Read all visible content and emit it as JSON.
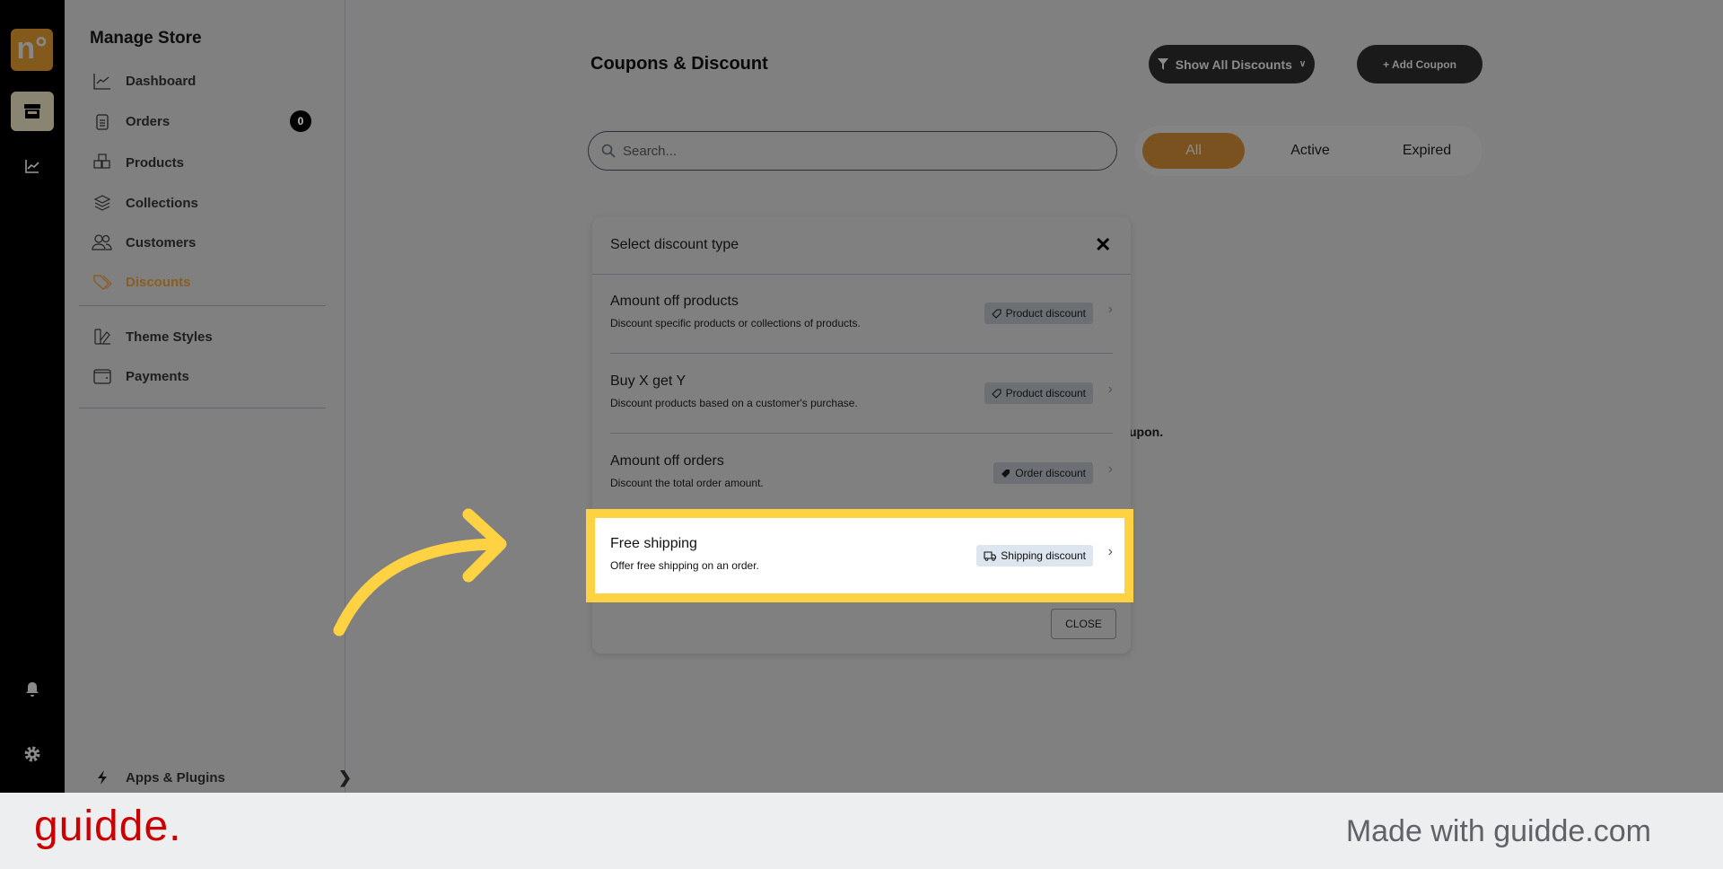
{
  "rail": {
    "logo": "n°",
    "icons": [
      "store-icon",
      "chart-icon",
      "bell-icon",
      "gear-icon"
    ]
  },
  "sidebar": {
    "title": "Manage Store",
    "items": [
      {
        "label": "Dashboard",
        "icon": "chart-line-icon"
      },
      {
        "label": "Orders",
        "icon": "clipboard-icon",
        "badge": "0"
      },
      {
        "label": "Products",
        "icon": "boxes-icon"
      },
      {
        "label": "Collections",
        "icon": "layers-icon"
      },
      {
        "label": "Customers",
        "icon": "users-icon"
      },
      {
        "label": "Discounts",
        "icon": "tag-icon",
        "active": true
      },
      {
        "label": "Theme Styles",
        "icon": "palette-icon"
      },
      {
        "label": "Payments",
        "icon": "wallet-icon"
      }
    ],
    "footer_item": {
      "label": "Apps & Plugins",
      "icon": "bolt-icon"
    }
  },
  "main": {
    "title": "Coupons & Discount",
    "filter_button": "Show All Discounts",
    "add_button": "+ Add Coupon",
    "search_placeholder": "Search...",
    "tabs": [
      "All",
      "Active",
      "Expired"
    ],
    "selected_tab": "All",
    "behind_text": "upon."
  },
  "modal": {
    "title": "Select discount type",
    "options": [
      {
        "title": "Amount off products",
        "desc": "Discount specific products or collections of products.",
        "tag": "Product discount",
        "tag_icon": "tag-outline-icon"
      },
      {
        "title": "Buy X get Y",
        "desc": "Discount products based on a customer's purchase.",
        "tag": "Product discount",
        "tag_icon": "tag-outline-icon"
      },
      {
        "title": "Amount off orders",
        "desc": "Discount the total order amount.",
        "tag": "Order discount",
        "tag_icon": "tag-filled-icon"
      },
      {
        "title": "Free shipping",
        "desc": "Offer free shipping on an order.",
        "tag": "Shipping discount",
        "tag_icon": "truck-icon",
        "highlighted": true
      }
    ],
    "close_label": "CLOSE"
  },
  "colors": {
    "accent": "#f0a030",
    "highlight": "#ffd243",
    "brand": "#cc0000"
  },
  "footer": {
    "brand": "guidde.",
    "made_with": "Made with guidde.com"
  }
}
